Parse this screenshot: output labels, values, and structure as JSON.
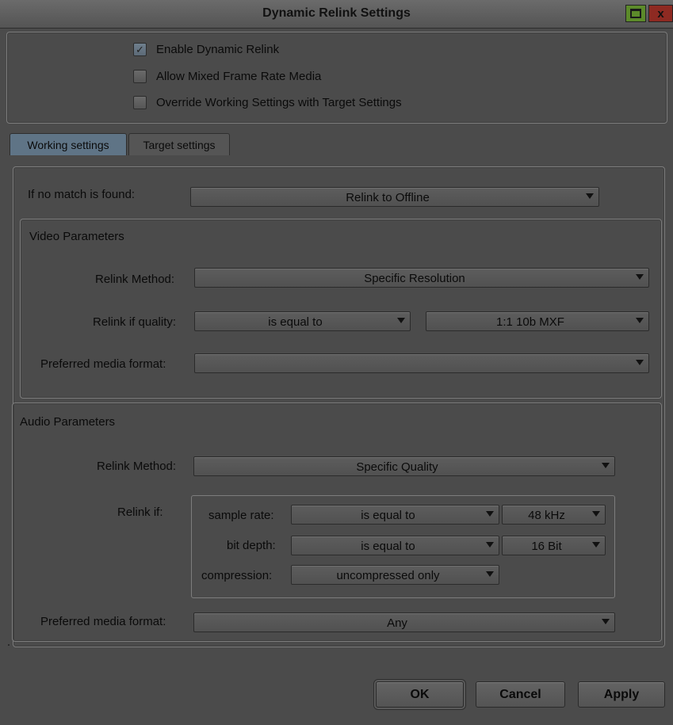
{
  "window": {
    "title": "Dynamic Relink Settings",
    "maximize_icon": "maximize-icon",
    "close_icon": "close-icon",
    "close_glyph": "x"
  },
  "options": {
    "enable_dynamic_relink": {
      "label": "Enable Dynamic Relink",
      "checked": true
    },
    "allow_mixed_frame_rate": {
      "label": "Allow Mixed Frame Rate Media",
      "checked": false
    },
    "override_working_settings": {
      "label": "Override Working Settings with Target Settings",
      "checked": false
    }
  },
  "tabs": [
    {
      "label": "Working settings",
      "active": true
    },
    {
      "label": "Target settings",
      "active": false
    }
  ],
  "no_match": {
    "label": "If no match is found:",
    "value": "Relink to Offline"
  },
  "video": {
    "title": "Video Parameters",
    "relink_method_label": "Relink Method:",
    "relink_method_value": "Specific Resolution",
    "relink_quality_label": "Relink if quality:",
    "quality_condition": "is equal to",
    "quality_value": "1:1 10b  MXF",
    "preferred_format_label": "Preferred media format:",
    "preferred_format_value": ""
  },
  "audio": {
    "title": "Audio Parameters",
    "relink_method_label": "Relink Method:",
    "relink_method_value": "Specific Quality",
    "relink_if_label": "Relink if:",
    "sample_rate_label": "sample rate:",
    "sample_rate_condition": "is equal to",
    "sample_rate_value": "48 kHz",
    "bit_depth_label": "bit depth:",
    "bit_depth_condition": "is equal to",
    "bit_depth_value": "16 Bit",
    "compression_label": "compression:",
    "compression_value": "uncompressed only",
    "preferred_format_label": "Preferred media format:",
    "preferred_format_value": "Any"
  },
  "buttons": {
    "ok": "OK",
    "cancel": "Cancel",
    "apply": "Apply"
  },
  "colors": {
    "background": "#4b4b4b",
    "active_tab": "#5f7486",
    "maximize": "#5c8a2a",
    "close": "#8e2a22"
  }
}
